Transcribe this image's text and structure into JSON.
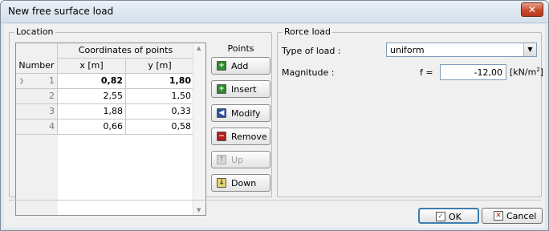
{
  "window": {
    "title": "New free surface load",
    "close_glyph": "✕"
  },
  "location": {
    "group_title": "Location",
    "grid": {
      "header_top": "Coordinates of points",
      "col_number": "Number",
      "col_x": "x [m]",
      "col_y": "y [m]",
      "rows": [
        {
          "num": "1",
          "x": "0,82",
          "y": "1,80",
          "selected": true
        },
        {
          "num": "2",
          "x": "2,55",
          "y": "1,50"
        },
        {
          "num": "3",
          "x": "1,88",
          "y": "0,33"
        },
        {
          "num": "4",
          "x": "0,66",
          "y": "0,58"
        }
      ]
    },
    "points": {
      "label": "Points",
      "add": "Add",
      "insert": "Insert",
      "modify": "Modify",
      "remove": "Remove",
      "up": "Up",
      "down": "Down"
    }
  },
  "load": {
    "group_title": "Rorce load",
    "type_label": "Type of load :",
    "type_value": "uniform",
    "magnitude_label": "Magnitude :",
    "f_label": "f =",
    "f_value": "-12,00",
    "unit": "[kN/m",
    "unit_sup": "2",
    "unit_end": "]"
  },
  "buttons": {
    "ok": "OK",
    "cancel": "Cancel"
  },
  "icons": {
    "add": "add-icon",
    "insert": "insert-icon",
    "modify": "modify-icon",
    "remove": "remove-icon",
    "up": "up-arrow-icon",
    "down": "down-arrow-icon",
    "ok": "check-icon",
    "cancel": "cancel-x-icon"
  },
  "colors": {
    "accent_green": "#2e8b2e",
    "accent_red": "#b32020",
    "window_bg": "#f0f0f0"
  }
}
